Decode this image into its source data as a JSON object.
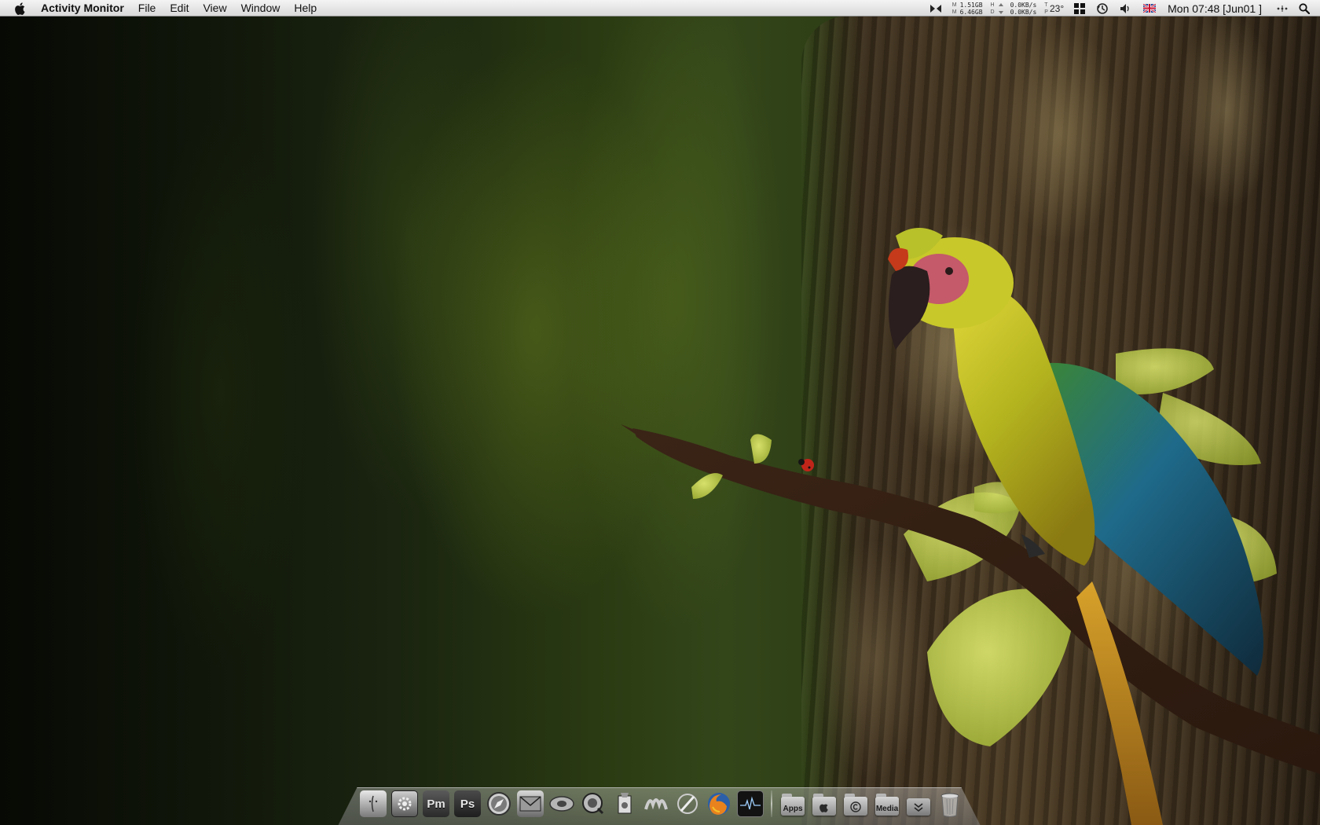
{
  "menubar": {
    "app_name": "Activity Monitor",
    "menus": [
      "File",
      "Edit",
      "View",
      "Window",
      "Help"
    ],
    "memory": {
      "used": "1.51GB",
      "free": "6.46GB"
    },
    "network": {
      "up": "0.0KB/s",
      "down": "0.0KB/s"
    },
    "temperature": "23°",
    "clock": "Mon 07:48 [Jun01 ]",
    "icons": [
      "apple-icon",
      "menu-extra-icon",
      "memory-icon",
      "disk-icon",
      "network-arrows-icon",
      "temperature-icon",
      "spaces-icon",
      "time-machine-icon",
      "volume-icon",
      "uk-flag-icon",
      "clock",
      "bluetooth-dots-icon",
      "spotlight-icon"
    ]
  },
  "dock": {
    "items": [
      {
        "name": "finder-icon"
      },
      {
        "name": "system-preferences-icon"
      },
      {
        "name": "photomatix-icon",
        "label": "Pm"
      },
      {
        "name": "photoshop-icon",
        "label": "Ps"
      },
      {
        "name": "safari-icon"
      },
      {
        "name": "mail-icon"
      },
      {
        "name": "itunes-icon"
      },
      {
        "name": "quicktime-icon"
      },
      {
        "name": "itunes-cd-icon"
      },
      {
        "name": "script-editor-icon"
      },
      {
        "name": "pen-tool-icon"
      },
      {
        "name": "firefox-icon"
      },
      {
        "name": "activity-monitor-icon"
      }
    ],
    "folders": [
      {
        "name": "apps-folder",
        "label": "Apps"
      },
      {
        "name": "applications-folder"
      },
      {
        "name": "copyright-folder"
      },
      {
        "name": "media-folder",
        "label": "Media"
      },
      {
        "name": "downloads-stack"
      },
      {
        "name": "trash-icon"
      }
    ]
  },
  "colors": {
    "menubar_bg": "#e6e6e6",
    "wallpaper_green": "#33461a",
    "trunk_brown": "#4a3a24",
    "parrot_yellow": "#c8c82a",
    "parrot_blue": "#1f6a8a"
  }
}
